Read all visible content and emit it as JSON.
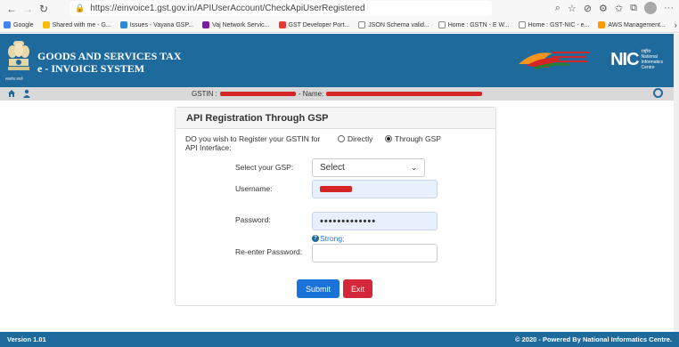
{
  "browser": {
    "url": "https://einvoice1.gst.gov.in/APIUserAccount/CheckApiUserRegistered",
    "bookmarks": [
      "Google",
      "Shared with me - G...",
      "Issues - Vayana GSP...",
      "Vaj Network Servic...",
      "GST Developer Port...",
      "JSON Schema valid...",
      "Home : GSTN - E W...",
      "Home : GST-NIC - e...",
      "AWS Management..."
    ]
  },
  "header": {
    "title_line1": "GOODS AND SERVICES TAX",
    "title_line2": "e - INVOICE SYSTEM",
    "nic": "NIC",
    "nic_sub1": "राष्ट्रीय",
    "nic_sub2": "National",
    "nic_sub3": "Informatics",
    "nic_sub4": "Centre",
    "emblem_caption": "सत्यमेव जयते"
  },
  "gstin_bar": {
    "gstin_label": "GSTIN :",
    "name_label": "- Name:"
  },
  "form": {
    "title": "API Registration Through GSP",
    "question": "DO you wish to Register your GSTIN for API Interface:",
    "option_directly": "Directly",
    "option_gsp": "Through GSP",
    "gsp_label": "Select your GSP:",
    "gsp_value": "Select",
    "username_label": "Username:",
    "password_label": "Password:",
    "password_value": "•••••••••••••",
    "strength": "Strong;",
    "reenter_label": "Re-enter Password:",
    "submit_label": "Submit",
    "exit_label": "Exit"
  },
  "footer": {
    "version": "Version 1.01",
    "copyright": "© 2020 - Powered By National Informatics Centre."
  },
  "colors": {
    "header_blue": "#1e6a9c",
    "submit_blue": "#1a73d8",
    "exit_red": "#d2283a",
    "redaction_red": "#d42424"
  }
}
